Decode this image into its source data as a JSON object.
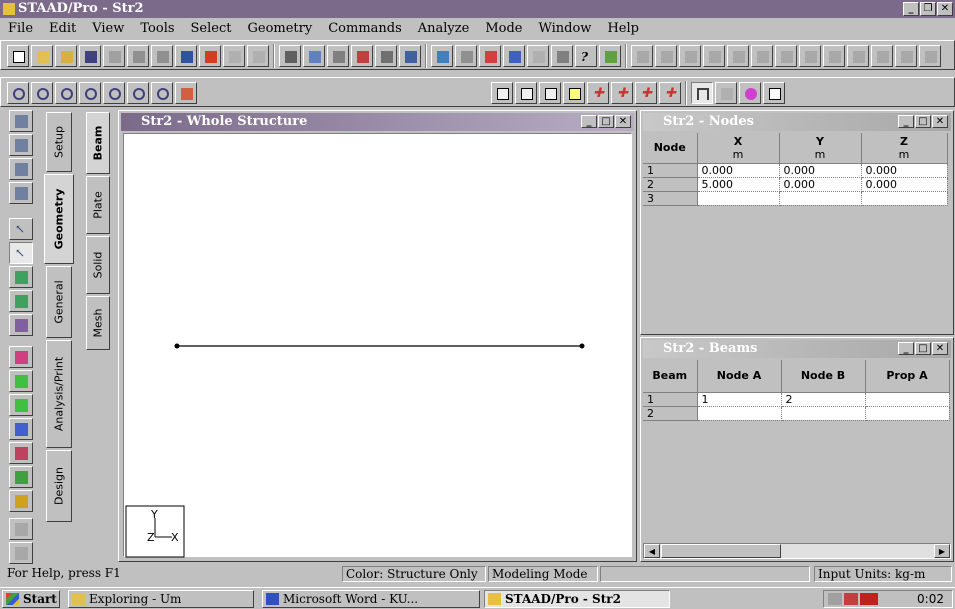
{
  "app": {
    "title": "STAAD/Pro - Str2"
  },
  "menu": [
    "File",
    "Edit",
    "View",
    "Tools",
    "Select",
    "Geometry",
    "Commands",
    "Analyze",
    "Mode",
    "Window",
    "Help"
  ],
  "toolbar": {
    "view_combo_value": ""
  },
  "left_tabs": {
    "page_tabs": [
      "Setup",
      "Geometry",
      "General",
      "Analysis/Print",
      "Design"
    ],
    "sub_tabs": [
      "Beam",
      "Plate",
      "Solid",
      "Mesh"
    ]
  },
  "main_window": {
    "title": "Str2 - Whole Structure",
    "axis_labels": {
      "y": "Y",
      "z": "Z",
      "x": "X"
    }
  },
  "nodes_window": {
    "title": "Str2 - Nodes",
    "headers": [
      [
        "Node",
        ""
      ],
      [
        "X",
        "m"
      ],
      [
        "Y",
        "m"
      ],
      [
        "Z",
        "m"
      ]
    ],
    "rows": [
      [
        "1",
        "0.000",
        "0.000",
        "0.000"
      ],
      [
        "2",
        "5.000",
        "0.000",
        "0.000"
      ],
      [
        "3",
        "",
        "",
        ""
      ]
    ]
  },
  "beams_window": {
    "title": "Str2 - Beams",
    "headers": [
      "Beam",
      "Node A",
      "Node B",
      "Prop A"
    ],
    "rows": [
      [
        "1",
        "1",
        "2",
        ""
      ],
      [
        "2",
        "",
        "",
        ""
      ]
    ]
  },
  "status": {
    "help": "For Help, press F1",
    "color": "Color: Structure Only",
    "mode": "Modeling Mode",
    "units": "Input Units:  kg-m"
  },
  "taskbar": {
    "start": "Start",
    "tasks": [
      "Exploring - Um",
      "Microsoft Word - KU...",
      "STAAD/Pro - Str2"
    ],
    "clock": "0:02"
  },
  "colors": {
    "title_active": "#7b6a8a",
    "title_inactive": "#a8a8a8",
    "desktop": "#c0c0c0"
  }
}
